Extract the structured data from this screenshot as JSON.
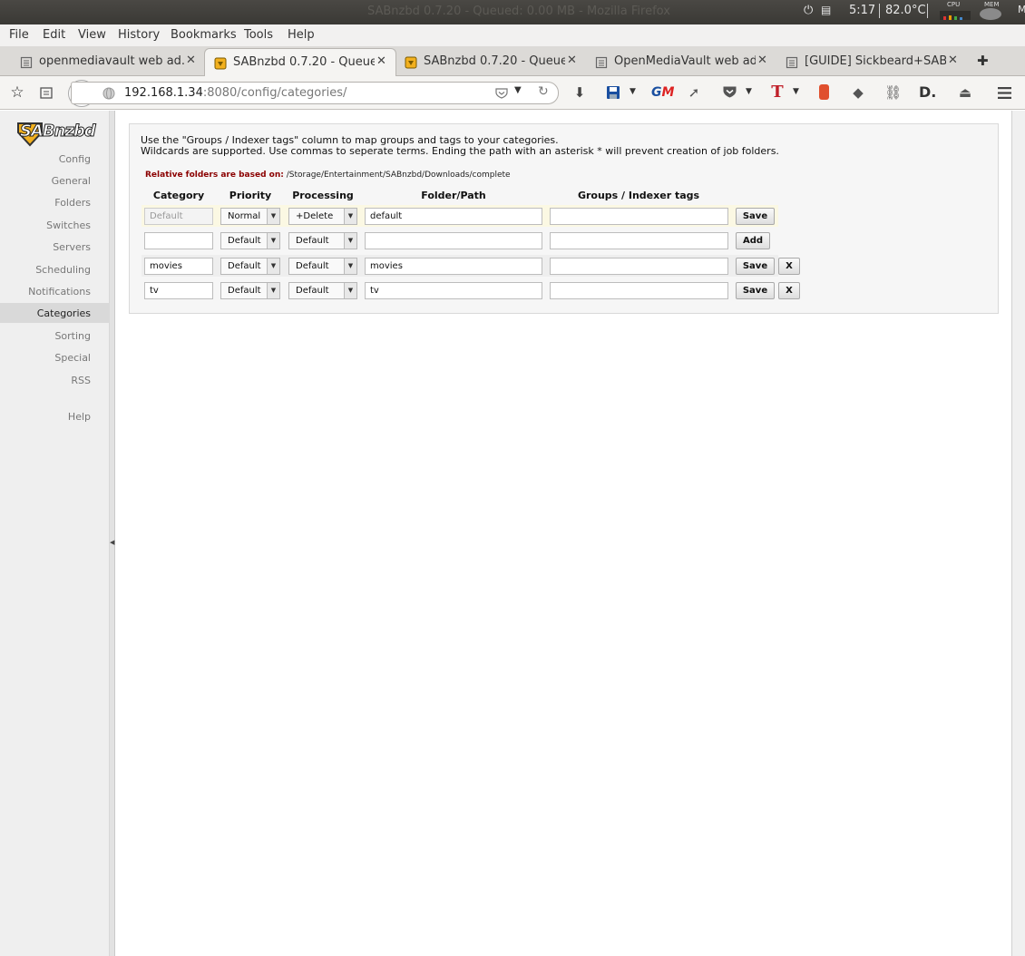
{
  "system_bar": {
    "window_title": "SABnzbd 0.7.20 - Queued: 0.00 MB - Mozilla Firefox",
    "time": "5:17",
    "temperature": "82.0°C",
    "cpu_label": "CPU",
    "mem_label": "MEM"
  },
  "menu": {
    "items": [
      "File",
      "Edit",
      "View",
      "History",
      "Bookmarks",
      "Tools",
      "Help"
    ]
  },
  "tabs": [
    {
      "label": "openmediavault web ad...",
      "active": false,
      "icon": "page-icon"
    },
    {
      "label": "SABnzbd 0.7.20 - Queued...",
      "active": true,
      "icon": "sabnzbd-favicon-icon"
    },
    {
      "label": "SABnzbd 0.7.20 - Queued...",
      "active": false,
      "icon": "sabnzbd-favicon-icon"
    },
    {
      "label": "OpenMediaVault web ad...",
      "active": false,
      "icon": "page-icon"
    },
    {
      "label": "[GUIDE] Sickbeard+SABn...",
      "active": false,
      "icon": "page-icon"
    }
  ],
  "navbar": {
    "url_host": "192.168.1.34",
    "url_rest": ":8080/config/categories/"
  },
  "sidebar": {
    "logo_text": "SABnzbd",
    "items": [
      {
        "label": "Config"
      },
      {
        "label": "General"
      },
      {
        "label": "Folders"
      },
      {
        "label": "Switches"
      },
      {
        "label": "Servers"
      },
      {
        "label": "Scheduling"
      },
      {
        "label": "Notifications"
      },
      {
        "label": "Categories",
        "selected": true
      },
      {
        "label": "Sorting"
      },
      {
        "label": "Special"
      },
      {
        "label": "RSS"
      },
      {
        "label": "Help"
      }
    ]
  },
  "content": {
    "info_line1": "Use the \"Groups / Indexer tags\" column to map groups and tags to your categories.",
    "info_line2": "Wildcards are supported. Use commas to seperate terms. Ending the path with an asterisk * will prevent creation of job folders.",
    "relative_label": "Relative folders are based on:",
    "relative_path": "/Storage/Entertainment/SABnzbd/Downloads/complete",
    "headers": {
      "category": "Category",
      "priority": "Priority",
      "processing": "Processing",
      "folder": "Folder/Path",
      "groups": "Groups / Indexer tags"
    },
    "rows": [
      {
        "category": "Default",
        "priority": "Normal",
        "processing": "+Delete",
        "folder": "default",
        "groups": "",
        "action": "Save",
        "delete": ""
      },
      {
        "category": "",
        "priority": "Default",
        "processing": "Default",
        "folder": "",
        "groups": "",
        "action": "Add",
        "delete": ""
      },
      {
        "category": "movies",
        "priority": "Default",
        "processing": "Default",
        "folder": "movies",
        "groups": "",
        "action": "Save",
        "delete": "X"
      },
      {
        "category": "tv",
        "priority": "Default",
        "processing": "Default",
        "folder": "tv",
        "groups": "",
        "action": "Save",
        "delete": "X"
      }
    ]
  }
}
